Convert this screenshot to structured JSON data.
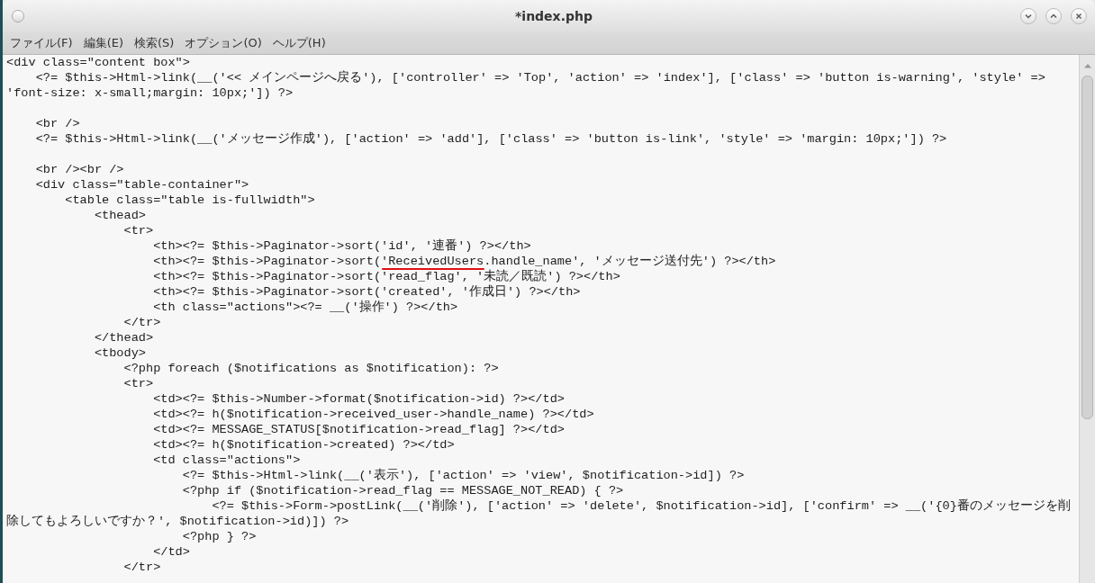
{
  "window": {
    "title": "*index.php"
  },
  "menu": [
    "ファイル(F)",
    "編集(E)",
    "検索(S)",
    "オプション(O)",
    "ヘルプ(H)"
  ],
  "editor": {
    "blocks": [
      [
        "<div class=\"content box\">",
        "    <?= $this->Html->link(__('<< メインページへ戻る'), ['controller' => 'Top', 'action' => 'index'], ['class' => 'button is-warning', 'style' =>",
        "'font-size: x-small;margin: 10px;']) ?>"
      ],
      [
        "    <br />",
        "    <?= $this->Html->link(__('メッセージ作成'), ['action' => 'add'], ['class' => 'button is-link', 'style' => 'margin: 10px;']) ?>"
      ],
      [
        "    <br /><br />",
        "    <div class=\"table-container\">",
        "        <table class=\"table is-fullwidth\">",
        "            <thead>",
        "                <tr>",
        "                    <th><?= $this->Paginator->sort('id', '連番') ?></th>",
        "                    <th><?= $this->Paginator->sort('ReceivedUsers.handle_name', 'メッセージ送付先') ?></th>",
        "                    <th><?= $this->Paginator->sort('read_flag', '未読／既読') ?></th>",
        "                    <th><?= $this->Paginator->sort('created', '作成日') ?></th>",
        "                    <th class=\"actions\"><?= __('操作') ?></th>",
        "                </tr>",
        "            </thead>",
        "            <tbody>",
        "                <?php foreach ($notifications as $notification): ?>",
        "                <tr>",
        "                    <td><?= $this->Number->format($notification->id) ?></td>",
        "                    <td><?= h($notification->received_user->handle_name) ?></td>",
        "                    <td><?= MESSAGE_STATUS[$notification->read_flag] ?></td>",
        "                    <td><?= h($notification->created) ?></td>",
        "                    <td class=\"actions\">",
        "                        <?= $this->Html->link(__('表示'), ['action' => 'view', $notification->id]) ?>",
        "                        <?php if ($notification->read_flag == MESSAGE_NOT_READ) { ?>",
        "                            <?= $this->Form->postLink(__('削除'), ['action' => 'delete', $notification->id], ['confirm' => __('{0}番のメッセージを削",
        "除してもよろしいですか？', $notification->id)]) ?>",
        "                        <?php } ?>",
        "                    </td>",
        "                </tr>"
      ]
    ]
  }
}
